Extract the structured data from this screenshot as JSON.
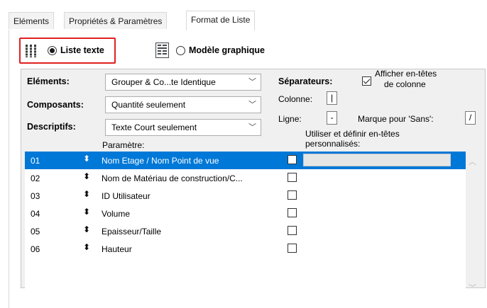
{
  "tabs": [
    {
      "label": "Eléments",
      "active": false
    },
    {
      "label": "Propriétés & Paramètres",
      "active": false
    },
    {
      "label": "Format de Liste",
      "active": true
    }
  ],
  "mode": {
    "list_text": "Liste texte",
    "graphic_model": "Modèle graphique",
    "selected": "list_text"
  },
  "left_fields": {
    "elements_label": "Eléments:",
    "elements_value": "Grouper & Co...te Identique",
    "components_label": "Composants:",
    "components_value": "Quantité seulement",
    "descriptifs_label": "Descriptifs:",
    "descriptifs_value": "Texte Court seulement"
  },
  "separators": {
    "title": "Séparateurs:",
    "column_label": "Colonne:",
    "column_value": "|",
    "line_label": "Ligne:",
    "line_value": "-",
    "without_label": "Marque pour 'Sans':",
    "without_value": "/"
  },
  "show_headers": {
    "line1": "Afficher en-têtes",
    "line2": "de colonne",
    "checked": true
  },
  "custom_headers": {
    "line1": "Utiliser et définir en-têtes",
    "line2": "personnalisés:"
  },
  "list_header": "Paramètre:",
  "rows": [
    {
      "num": "01",
      "name": "Nom Etage / Nom Point de vue",
      "selected": true
    },
    {
      "num": "02",
      "name": "Nom de Matériau de construction/C...",
      "selected": false
    },
    {
      "num": "03",
      "name": "ID Utilisateur",
      "selected": false
    },
    {
      "num": "04",
      "name": "Volume",
      "selected": false
    },
    {
      "num": "05",
      "name": "Epaisseur/Taille",
      "selected": false
    },
    {
      "num": "06",
      "name": "Hauteur",
      "selected": false
    }
  ],
  "icons": {
    "list_text": "list-columns-icon",
    "graphic_model": "graphic-model-icon",
    "reorder": "reorder-arrows-icon",
    "dropdown": "chevron-down-icon"
  }
}
